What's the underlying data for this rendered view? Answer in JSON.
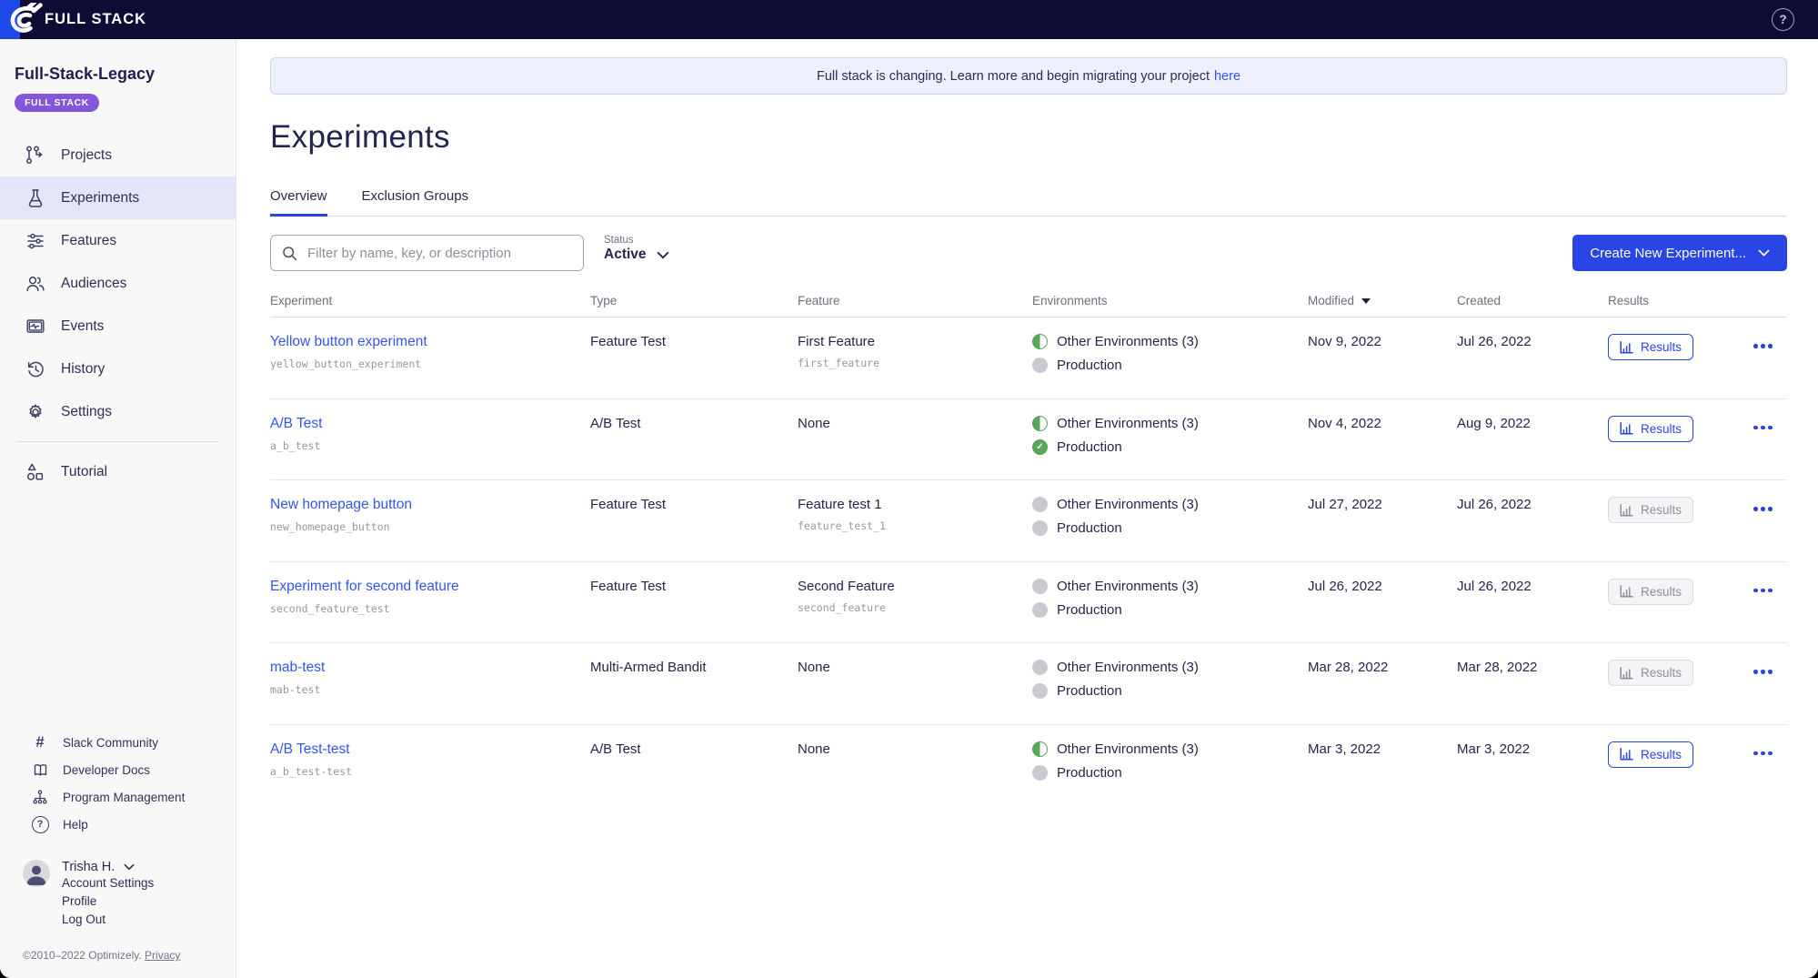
{
  "colors": {
    "topbar_bg": "#0E0C34",
    "logo_blue": "#1D49E8",
    "accent_blue": "#2945E5",
    "link_blue": "#3355F0",
    "badge_purple": "#8456DB",
    "env_green": "#57A75A"
  },
  "topbar": {
    "brand": "FULL STACK",
    "help": "?"
  },
  "sidebar": {
    "project_name": "Full-Stack-Legacy",
    "project_badge": "FULL STACK",
    "nav": [
      {
        "id": "projects",
        "label": "Projects",
        "active": false
      },
      {
        "id": "experiments",
        "label": "Experiments",
        "active": true
      },
      {
        "id": "features",
        "label": "Features",
        "active": false
      },
      {
        "id": "audiences",
        "label": "Audiences",
        "active": false
      },
      {
        "id": "events",
        "label": "Events",
        "active": false
      },
      {
        "id": "history",
        "label": "History",
        "active": false
      },
      {
        "id": "settings",
        "label": "Settings",
        "active": false
      },
      {
        "id": "tutorial",
        "label": "Tutorial",
        "active": false
      }
    ],
    "footer_nav": [
      {
        "id": "slack",
        "label": "Slack Community"
      },
      {
        "id": "docs",
        "label": "Developer Docs"
      },
      {
        "id": "program",
        "label": "Program Management"
      },
      {
        "id": "help",
        "label": "Help"
      }
    ],
    "user": {
      "name": "Trisha H.",
      "links": [
        "Account Settings",
        "Profile",
        "Log Out"
      ]
    },
    "copyright": "©2010–2022 Optimizely. ",
    "privacy_link": "Privacy"
  },
  "banner": {
    "text": "Full stack is changing. Learn more and begin migrating your project",
    "link_text": "here"
  },
  "page": {
    "title": "Experiments",
    "tabs": [
      {
        "label": "Overview",
        "active": true
      },
      {
        "label": "Exclusion Groups",
        "active": false
      }
    ]
  },
  "toolbar": {
    "filter_placeholder": "Filter by name, key, or description",
    "status_label": "Status",
    "status_value": "Active",
    "create_button": "Create New Experiment..."
  },
  "table": {
    "columns": [
      "Experiment",
      "Type",
      "Feature",
      "Environments",
      "Modified",
      "Created",
      "Results"
    ],
    "sorted_by": "Modified",
    "results_label": "Results",
    "rows": [
      {
        "name": "Yellow button experiment",
        "key": "yellow_button_experiment",
        "type": "Feature Test",
        "feature": "First Feature",
        "feature_key": "first_feature",
        "environments": [
          {
            "label": "Other Environments (3)",
            "state": "partial"
          },
          {
            "label": "Production",
            "state": "off"
          }
        ],
        "modified": "Nov 9, 2022",
        "created": "Jul 26, 2022",
        "results_enabled": true
      },
      {
        "name": "A/B Test",
        "key": "a_b_test",
        "type": "A/B Test",
        "feature": "None",
        "feature_key": "",
        "environments": [
          {
            "label": "Other Environments (3)",
            "state": "partial"
          },
          {
            "label": "Production",
            "state": "on"
          }
        ],
        "modified": "Nov 4, 2022",
        "created": "Aug 9, 2022",
        "results_enabled": true
      },
      {
        "name": "New homepage button",
        "key": "new_homepage_button",
        "type": "Feature Test",
        "feature": "Feature test 1",
        "feature_key": "feature_test_1",
        "environments": [
          {
            "label": "Other Environments (3)",
            "state": "off"
          },
          {
            "label": "Production",
            "state": "off"
          }
        ],
        "modified": "Jul 27, 2022",
        "created": "Jul 26, 2022",
        "results_enabled": false
      },
      {
        "name": "Experiment for second feature",
        "key": "second_feature_test",
        "type": "Feature Test",
        "feature": "Second Feature",
        "feature_key": "second_feature",
        "environments": [
          {
            "label": "Other Environments (3)",
            "state": "off"
          },
          {
            "label": "Production",
            "state": "off"
          }
        ],
        "modified": "Jul 26, 2022",
        "created": "Jul 26, 2022",
        "results_enabled": false
      },
      {
        "name": "mab-test",
        "key": "mab-test",
        "type": "Multi-Armed Bandit",
        "feature": "None",
        "feature_key": "",
        "environments": [
          {
            "label": "Other Environments (3)",
            "state": "off"
          },
          {
            "label": "Production",
            "state": "off"
          }
        ],
        "modified": "Mar 28, 2022",
        "created": "Mar 28, 2022",
        "results_enabled": false
      },
      {
        "name": "A/B Test-test",
        "key": "a_b_test-test",
        "type": "A/B Test",
        "feature": "None",
        "feature_key": "",
        "environments": [
          {
            "label": "Other Environments (3)",
            "state": "partial"
          },
          {
            "label": "Production",
            "state": "off"
          }
        ],
        "modified": "Mar 3, 2022",
        "created": "Mar 3, 2022",
        "results_enabled": true
      }
    ]
  }
}
